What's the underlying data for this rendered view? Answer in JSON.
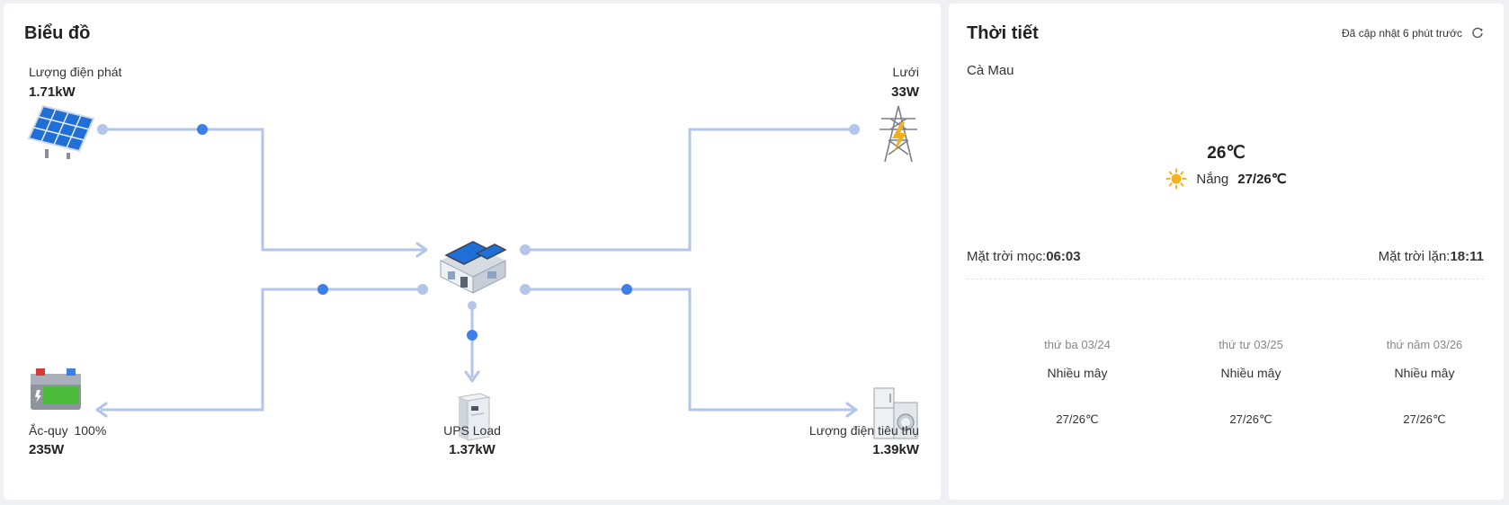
{
  "diagram": {
    "title": "Biểu đồ",
    "pv": {
      "label": "Lượng điện phát",
      "value": "1.71kW"
    },
    "grid": {
      "label": "Lưới",
      "value": "33W"
    },
    "battery": {
      "label": "Ắc-quy",
      "percent": "100%",
      "value": "235W"
    },
    "ups": {
      "label": "UPS Load",
      "value": "1.37kW"
    },
    "load": {
      "label": "Lượng điện tiêu thụ",
      "value": "1.39kW"
    },
    "colors": {
      "line": "#b3c6ea",
      "dot": "#3d7ee8",
      "endpoint": "#b3c6ea"
    }
  },
  "weather": {
    "title": "Thời tiết",
    "updated": "Đã cập nhật 6 phút trước",
    "refresh_icon": "refresh-icon",
    "location": "Cà Mau",
    "current_temp": "26℃",
    "condition": "Nắng",
    "range": "27/26℃",
    "condition_icon": "sun-icon",
    "sunrise_label": "Mặt trời mọc:",
    "sunrise": "06:03",
    "sunset_label": "Mặt trời lặn:",
    "sunset": "18:11",
    "forecast": [
      {
        "day": "thứ ba 03/24",
        "condition": "Nhiều mây",
        "temp": "27/26℃"
      },
      {
        "day": "thứ tư 03/25",
        "condition": "Nhiều mây",
        "temp": "27/26℃"
      },
      {
        "day": "thứ năm 03/26",
        "condition": "Nhiều mây",
        "temp": "27/26℃"
      }
    ]
  }
}
